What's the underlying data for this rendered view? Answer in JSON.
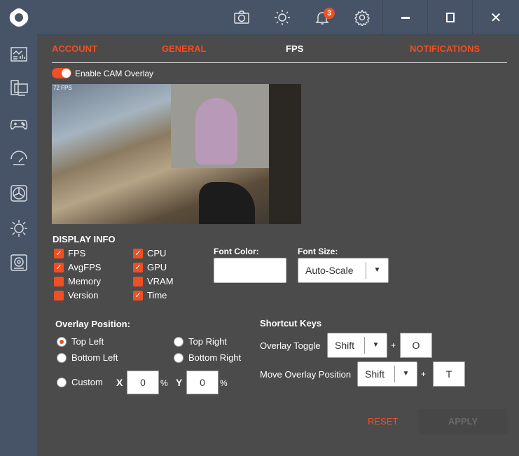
{
  "topbar": {
    "notification_count": "3",
    "icons": [
      "camera-icon",
      "brightness-icon",
      "bell-icon",
      "gear-icon"
    ],
    "minimize": "–",
    "close": "✕"
  },
  "sidebar": {
    "icons": [
      "dashboard-icon",
      "monitor-icon",
      "gamepad-icon",
      "gauge-icon",
      "fan-icon",
      "brightness-icon",
      "storage-icon"
    ]
  },
  "tabs": [
    {
      "label": "ACCOUNT"
    },
    {
      "label": "GENERAL"
    },
    {
      "label": "FPS"
    },
    {
      "label": "NOTIFICATIONS"
    }
  ],
  "overlay": {
    "enable_label": "Enable CAM Overlay",
    "enabled": true,
    "preview_fps": "72 FPS"
  },
  "display_info": {
    "title": "DISPLAY INFO",
    "items": [
      {
        "label": "FPS",
        "checked": true
      },
      {
        "label": "AvgFPS",
        "checked": true
      },
      {
        "label": "Memory",
        "checked": false
      },
      {
        "label": "Version",
        "checked": false
      },
      {
        "label": "CPU",
        "checked": true
      },
      {
        "label": "GPU",
        "checked": true
      },
      {
        "label": "VRAM",
        "checked": false
      },
      {
        "label": "Time",
        "checked": true
      }
    ]
  },
  "font_color": {
    "label": "Font Color:",
    "value": "#ffffff"
  },
  "font_size": {
    "label": "Font Size:",
    "value": "Auto-Scale"
  },
  "position": {
    "title": "Overlay Position:",
    "options": [
      "Top Left",
      "Top Right",
      "Bottom Left",
      "Bottom Right",
      "Custom"
    ],
    "selected": "Top Left",
    "x_label": "X",
    "x": "0",
    "y_label": "Y",
    "y": "0",
    "unit": "%"
  },
  "shortcuts": {
    "title": "Shortcut Keys",
    "toggle_label": "Overlay Toggle",
    "toggle_mod": "Shift",
    "toggle_key": "O",
    "move_label": "Move Overlay Position",
    "move_mod": "Shift",
    "move_key": "T",
    "plus": "+"
  },
  "actions": {
    "reset": "RESET",
    "apply": "APPLY"
  }
}
